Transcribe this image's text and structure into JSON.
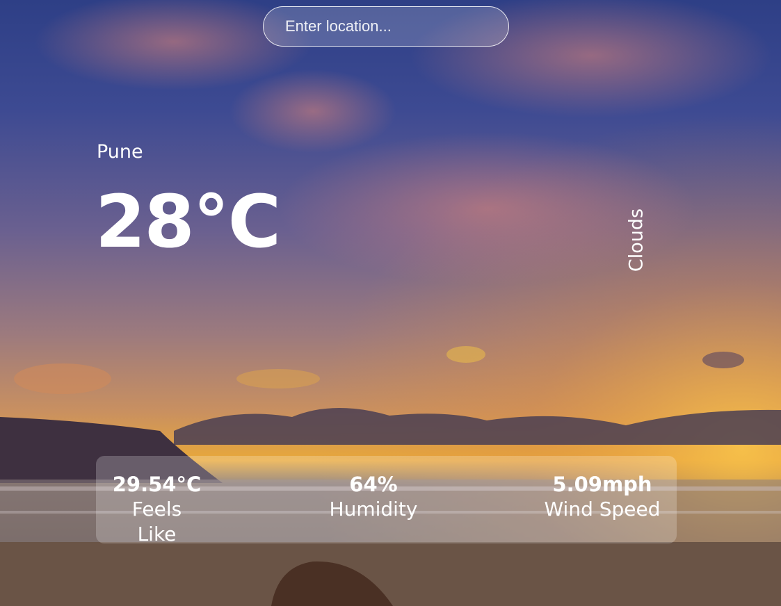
{
  "search": {
    "placeholder": "Enter location..."
  },
  "location": {
    "city": "Pune"
  },
  "current": {
    "temperature": "28°C",
    "condition": "Clouds"
  },
  "stats": [
    {
      "value": "29.54°C",
      "label": "Feels Like"
    },
    {
      "value": "64%",
      "label": "Humidity"
    },
    {
      "value": "5.09mph",
      "label": "Wind Speed"
    }
  ],
  "colors": {
    "sky_top": "#2b3a7e",
    "sunset": "#f0a030",
    "panel": "rgba(255,255,255,0.22)"
  }
}
